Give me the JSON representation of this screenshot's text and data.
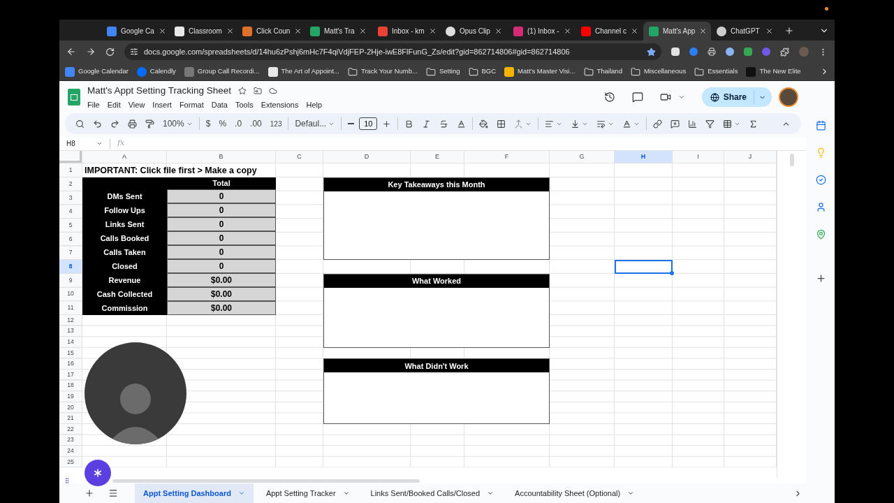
{
  "browser": {
    "tabs": [
      {
        "title": "Google Ca",
        "kind": "calendar",
        "selected": false
      },
      {
        "title": "Classroom",
        "kind": "sk",
        "selected": false
      },
      {
        "title": "Click Coun",
        "kind": "orange",
        "selected": false
      },
      {
        "title": "Matt's Tra",
        "kind": "sheets",
        "selected": false
      },
      {
        "title": "Inbox - km",
        "kind": "gmail",
        "selected": false
      },
      {
        "title": "Opus Clip",
        "kind": "opus",
        "selected": false
      },
      {
        "title": "(1) Inbox -",
        "kind": "instagram",
        "selected": false
      },
      {
        "title": "Channel c",
        "kind": "youtube",
        "selected": false
      },
      {
        "title": "Matt's App",
        "kind": "sheets",
        "selected": true
      },
      {
        "title": "ChatGPT",
        "kind": "chatgpt",
        "selected": false
      }
    ],
    "url": "docs.google.com/spreadsheets/d/14hu6zPshj6mHc7F4qiVdjFEP-2Hje-iwE8FlFunG_Zs/edit?gid=862714806#gid=862714806",
    "bookmarks": [
      {
        "label": "Google Calendar",
        "kind": "calendar"
      },
      {
        "label": "Calendly",
        "kind": "calendly"
      },
      {
        "label": "Group Call Recordi...",
        "kind": "app"
      },
      {
        "label": "The Art of Appoint...",
        "kind": "sk"
      },
      {
        "label": "Track Your Numb...",
        "kind": "folder"
      },
      {
        "label": "Setting",
        "kind": "folder"
      },
      {
        "label": "BGC",
        "kind": "folder"
      },
      {
        "label": "Matt's Master Visi...",
        "kind": "slides"
      },
      {
        "label": "Thailand",
        "kind": "folder"
      },
      {
        "label": "Miscellaneous",
        "kind": "folder"
      },
      {
        "label": "Essentials",
        "kind": "folder"
      },
      {
        "label": "The New Elite",
        "kind": "dark"
      }
    ]
  },
  "doc": {
    "title": "Matt's Appt Setting Tracking Sheet",
    "menu": [
      "File",
      "Edit",
      "View",
      "Insert",
      "Format",
      "Data",
      "Tools",
      "Extensions",
      "Help"
    ],
    "share": "Share"
  },
  "toolbar": {
    "zoom": "100%",
    "currency": "$",
    "percent": "%",
    "decrease_decimals": ".0",
    "increase_decimals": ".00",
    "number_format": "123",
    "font": "Defaul...",
    "font_size": "10"
  },
  "formula_bar": {
    "name_box": "H8",
    "fx": "fx"
  },
  "sheet": {
    "columns": [
      {
        "label": "A",
        "selected": false
      },
      {
        "label": "B",
        "selected": false
      },
      {
        "label": "C",
        "selected": false
      },
      {
        "label": "D",
        "selected": false
      },
      {
        "label": "E",
        "selected": false
      },
      {
        "label": "F",
        "selected": false
      },
      {
        "label": "G",
        "selected": false
      },
      {
        "label": "H",
        "selected": true
      },
      {
        "label": "I",
        "selected": false
      },
      {
        "label": "J",
        "selected": false
      }
    ],
    "rows": [
      {
        "label": "1",
        "selected": false
      },
      {
        "label": "2",
        "selected": false
      },
      {
        "label": "3",
        "selected": false
      },
      {
        "label": "4",
        "selected": false
      },
      {
        "label": "5",
        "selected": false
      },
      {
        "label": "6",
        "selected": false
      },
      {
        "label": "7",
        "selected": false
      },
      {
        "label": "8",
        "selected": true
      },
      {
        "label": "9",
        "selected": false
      },
      {
        "label": "10",
        "selected": false
      },
      {
        "label": "11",
        "selected": false
      },
      {
        "label": "12",
        "selected": false
      },
      {
        "label": "13",
        "selected": false
      },
      {
        "label": "14",
        "selected": false
      },
      {
        "label": "15",
        "selected": false
      },
      {
        "label": "16",
        "selected": false
      },
      {
        "label": "17",
        "selected": false
      },
      {
        "label": "18",
        "selected": false
      },
      {
        "label": "19",
        "selected": false
      },
      {
        "label": "20",
        "selected": false
      },
      {
        "label": "21",
        "selected": false
      },
      {
        "label": "22",
        "selected": false
      },
      {
        "label": "23",
        "selected": false
      },
      {
        "label": "24",
        "selected": false
      },
      {
        "label": "25",
        "selected": false
      }
    ],
    "notice": "IMPORTANT: Click file first > Make a copy",
    "total_header": "Total",
    "metrics": [
      {
        "label": "DMs Sent",
        "value": "0"
      },
      {
        "label": "Follow Ups",
        "value": "0"
      },
      {
        "label": "Links Sent",
        "value": "0"
      },
      {
        "label": "Calls Booked",
        "value": "0"
      },
      {
        "label": "Calls Taken",
        "value": "0"
      },
      {
        "label": "Closed",
        "value": "0"
      },
      {
        "label": "Revenue",
        "value": "$0.00"
      },
      {
        "label": "Cash Collected",
        "value": "$0.00"
      },
      {
        "label": "Commission",
        "value": "$0.00"
      }
    ],
    "panels": [
      {
        "title": "Key Takeaways this Month"
      },
      {
        "title": "What Worked"
      },
      {
        "title": "What Didn't Work"
      }
    ]
  },
  "sheet_tabs": [
    {
      "label": "Appt Setting Dashboard",
      "selected": true
    },
    {
      "label": "Appt Setting Tracker",
      "selected": false
    },
    {
      "label": "Links Sent/Booked Calls/Closed",
      "selected": false
    },
    {
      "label": "Accountability Sheet (Optional)",
      "selected": false
    }
  ]
}
